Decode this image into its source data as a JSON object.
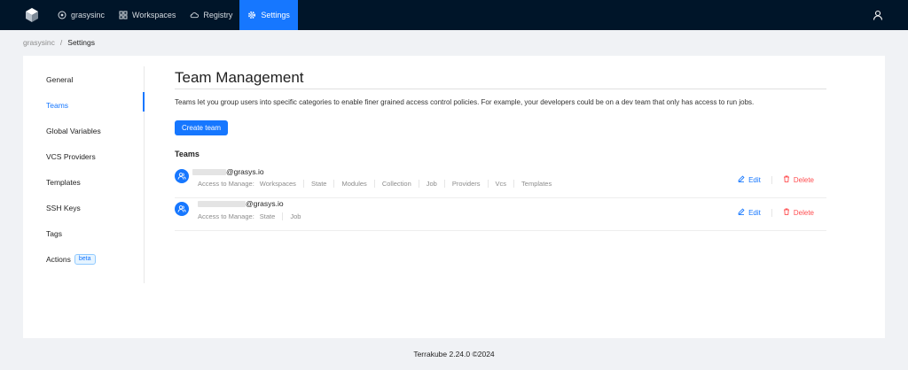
{
  "topbar": {
    "nav": [
      {
        "label": "grasysinc",
        "icon": "org-icon"
      },
      {
        "label": "Workspaces",
        "icon": "grid-icon"
      },
      {
        "label": "Registry",
        "icon": "cloud-icon"
      },
      {
        "label": "Settings",
        "icon": "gear-icon",
        "active": true
      }
    ],
    "user_icon": "user-icon"
  },
  "breadcrumb": {
    "root": "grasysinc",
    "separator": "/",
    "current": "Settings"
  },
  "sidebar": {
    "items": [
      {
        "label": "General"
      },
      {
        "label": "Teams",
        "active": true
      },
      {
        "label": "Global Variables"
      },
      {
        "label": "VCS Providers"
      },
      {
        "label": "Templates"
      },
      {
        "label": "SSH Keys"
      },
      {
        "label": "Tags"
      },
      {
        "label": "Actions",
        "badge": "beta"
      }
    ]
  },
  "main": {
    "title": "Team Management",
    "description": "Teams let you group users into specific categories to enable finer grained access control policies. For example, your developers could be on a dev team that only has access to run jobs.",
    "create_button": "Create team",
    "section_title": "Teams",
    "access_label": "Access to Manage:",
    "edit_label": "Edit",
    "delete_label": "Delete",
    "teams": [
      {
        "name_suffix": "@grasys.io",
        "access": [
          "Workspaces",
          "State",
          "Modules",
          "Collection",
          "Job",
          "Providers",
          "Vcs",
          "Templates"
        ]
      },
      {
        "name_suffix": "@grasys.io",
        "access": [
          "State",
          "Job"
        ]
      }
    ]
  },
  "footer": {
    "text": "Terrakube 2.24.0 ©2024"
  },
  "colors": {
    "topbar": "#001529",
    "accent": "#1677ff",
    "danger": "#ff4d4f",
    "page_bg": "#f0f2f5"
  }
}
